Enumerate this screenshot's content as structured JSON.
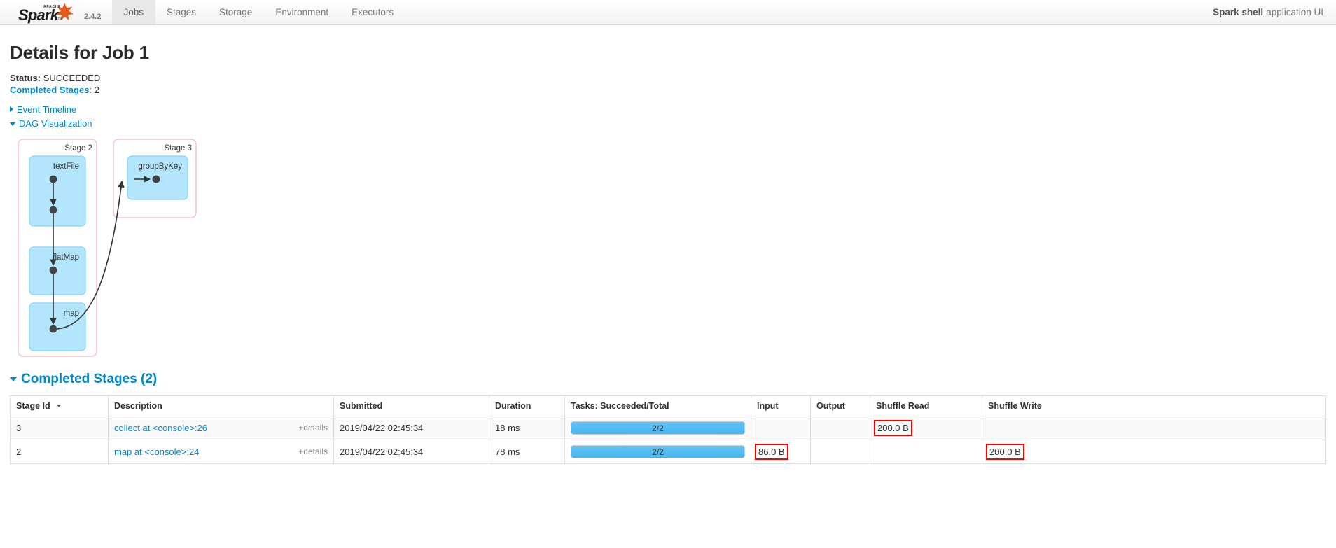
{
  "navbar": {
    "logo_alt": "Apache Spark",
    "logo_word": "Spark",
    "logo_super": "APACHE",
    "version": "2.4.2",
    "tabs": [
      {
        "label": "Jobs",
        "active": true
      },
      {
        "label": "Stages",
        "active": false
      },
      {
        "label": "Storage",
        "active": false
      },
      {
        "label": "Environment",
        "active": false
      },
      {
        "label": "Executors",
        "active": false
      }
    ],
    "app_name": "Spark shell",
    "app_suffix": "application UI"
  },
  "page": {
    "title": "Details for Job 1",
    "status_label": "Status:",
    "status_value": "SUCCEEDED",
    "completed_stages_label": "Completed Stages",
    "completed_stages_sep": ": ",
    "completed_stages_value": "2",
    "event_timeline_label": "Event Timeline",
    "dag_label": "DAG Visualization"
  },
  "dag": {
    "stages": [
      {
        "name": "Stage 2",
        "nodes": [
          {
            "label": "textFile"
          },
          {
            "label": "flatMap"
          },
          {
            "label": "map"
          }
        ]
      },
      {
        "name": "Stage 3",
        "nodes": [
          {
            "label": "groupByKey"
          }
        ]
      }
    ],
    "colors": {
      "stage_border": "#f5c6cb",
      "rdd_fill": "#b3e5fc",
      "rdd_border": "#81d4fa",
      "edge": "#333333"
    }
  },
  "completed_stages_section": {
    "heading": "Completed Stages (2)",
    "columns": [
      "Stage Id",
      "Description",
      "Submitted",
      "Duration",
      "Tasks: Succeeded/Total",
      "Input",
      "Output",
      "Shuffle Read",
      "Shuffle Write"
    ],
    "details_label": "+details",
    "rows": [
      {
        "stage_id": "3",
        "description": "collect at <console>:26",
        "submitted": "2019/04/22 02:45:34",
        "duration": "18 ms",
        "tasks_label": "2/2",
        "tasks_percent": 100,
        "input": "",
        "output": "",
        "shuffle_read": "200.0 B",
        "shuffle_write": "",
        "highlight": [
          "shuffle_read"
        ]
      },
      {
        "stage_id": "2",
        "description": "map at <console>:24",
        "submitted": "2019/04/22 02:45:34",
        "duration": "78 ms",
        "tasks_label": "2/2",
        "tasks_percent": 100,
        "input": "86.0 B",
        "output": "",
        "shuffle_read": "",
        "shuffle_write": "200.0 B",
        "highlight": [
          "input",
          "shuffle_write"
        ]
      }
    ],
    "annotation_color": "#ff0000"
  }
}
